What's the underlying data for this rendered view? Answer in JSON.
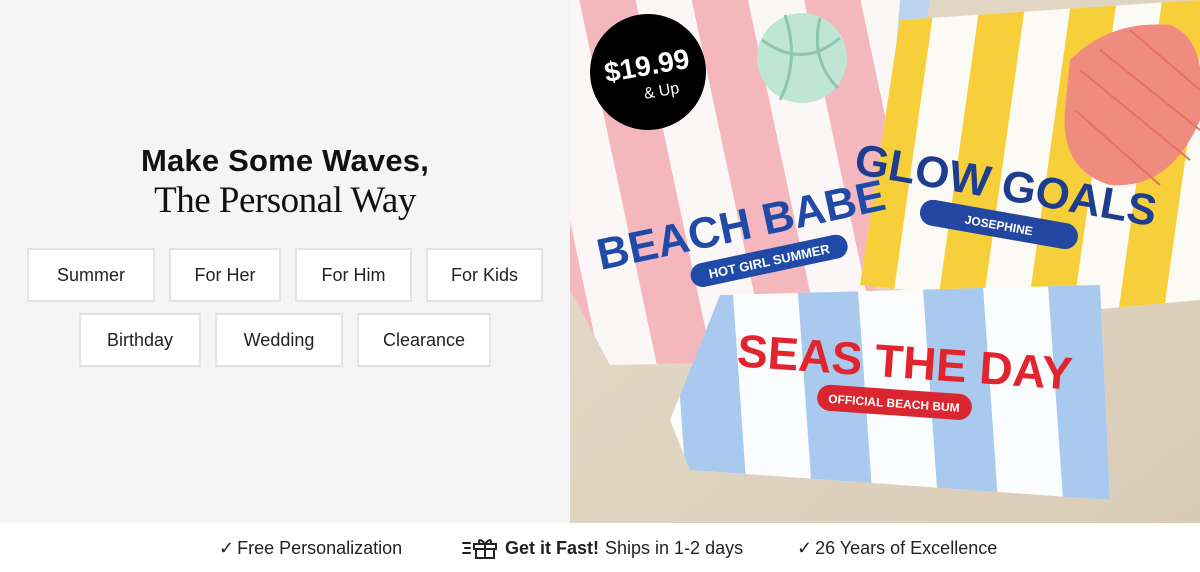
{
  "hero": {
    "headline_line1": "Make Some Waves,",
    "headline_line2": "The Personal Way",
    "categories_row1": [
      "Summer",
      "For Her",
      "For Him",
      "For Kids"
    ],
    "categories_row2": [
      "Birthday",
      "Wedding",
      "Clearance"
    ]
  },
  "promo": {
    "price": "$19.99",
    "price_suffix": "& Up",
    "badge_color": "#000000"
  },
  "towels": [
    {
      "title": "BEACH BABE",
      "tag": "HOT GIRL SUMMER",
      "title_color": "#1f4aa8",
      "tag_color": "#1f4aa8",
      "stripe_color": "#f3b7bd"
    },
    {
      "title": "GLOW GOALS",
      "tag": "JOSEPHINE",
      "title_color": "#1f3d8f",
      "tag_color": "#2346a0",
      "stripe_color": "#f6cf3a"
    },
    {
      "title": "SEAS THE DAY",
      "tag": "OFFICIAL BEACH BUM",
      "title_color": "#e1242e",
      "tag_color": "#d92630",
      "stripe_color": "#a9c9ee"
    }
  ],
  "features": {
    "item1": "Free Personalization",
    "item2_bold": "Get it Fast!",
    "item2_rest": "Ships in 1-2 days",
    "item3": "26 Years of Excellence",
    "check_icon": "checkmark-icon",
    "gift_icon": "gift-icon"
  }
}
